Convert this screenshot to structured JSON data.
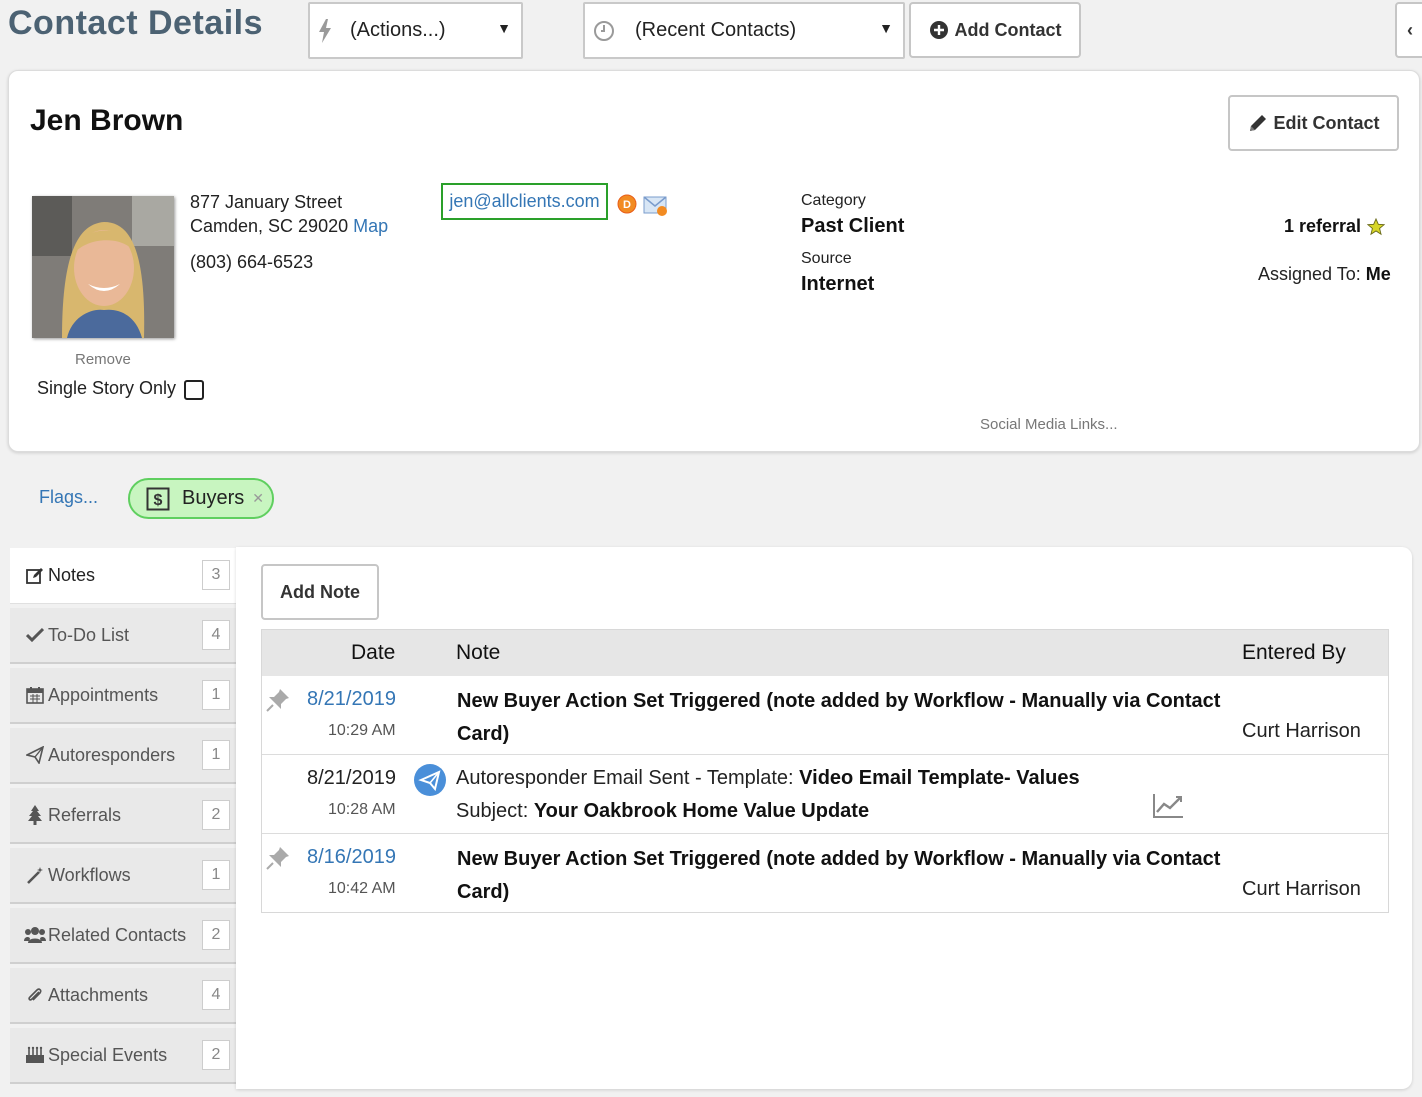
{
  "header": {
    "title": "Contact Details",
    "actions_label": "(Actions...)",
    "recent_label": "(Recent Contacts)",
    "add_contact_label": "Add Contact"
  },
  "contact": {
    "name": "Jen Brown",
    "edit_label": "Edit Contact",
    "address_line1": "877 January Street",
    "address_line2": "Camden, SC 29020",
    "map_label": "Map",
    "phone": "(803) 664-6523",
    "email": "jen@allclients.com",
    "remove_label": "Remove",
    "single_story_label": "Single Story Only",
    "category_label": "Category",
    "category_value": "Past Client",
    "source_label": "Source",
    "source_value": "Internet",
    "referral_text": "1 referral",
    "assigned_label": "Assigned To:",
    "assigned_value": "Me",
    "social_links_label": "Social Media Links..."
  },
  "flags": {
    "flags_label": "Flags...",
    "tag_label": "Buyers"
  },
  "sidebar": {
    "items": [
      {
        "label": "Notes",
        "count": "3",
        "icon": "edit-icon"
      },
      {
        "label": "To-Do List",
        "count": "4",
        "icon": "check-icon"
      },
      {
        "label": "Appointments",
        "count": "1",
        "icon": "calendar-icon"
      },
      {
        "label": "Autoresponders",
        "count": "1",
        "icon": "paper-plane-icon"
      },
      {
        "label": "Referrals",
        "count": "2",
        "icon": "tree-icon"
      },
      {
        "label": "Workflows",
        "count": "1",
        "icon": "magic-wand-icon"
      },
      {
        "label": "Related Contacts",
        "count": "2",
        "icon": "users-icon"
      },
      {
        "label": "Attachments",
        "count": "4",
        "icon": "paperclip-icon"
      },
      {
        "label": "Special Events",
        "count": "2",
        "icon": "birthday-cake-icon"
      }
    ]
  },
  "notes": {
    "add_note_label": "Add Note",
    "columns": {
      "date": "Date",
      "note": "Note",
      "entered_by": "Entered By"
    },
    "rows": [
      {
        "date": "8/21/2019",
        "time": "10:29 AM",
        "note_line1": "New Buyer Action Set Triggered (note added by Workflow - Manually via Contact",
        "note_line2": "Card)",
        "entered_by": "Curt Harrison"
      },
      {
        "date": "8/21/2019",
        "time": "10:28 AM",
        "template_prefix": "Autoresponder Email Sent - Template:",
        "template_name": "Video Email Template- Values",
        "subject_prefix": "Subject:",
        "subject": "Your Oakbrook Home Value Update"
      },
      {
        "date": "8/16/2019",
        "time": "10:42 AM",
        "note_line1": "New Buyer Action Set Triggered (note added by Workflow - Manually via Contact",
        "note_line2": "Card)",
        "entered_by": "Curt Harrison"
      }
    ]
  },
  "colors": {
    "title": "#4c6273",
    "link": "#3476b5",
    "tag_bg": "#c8f5c0",
    "tag_border": "#5fcf5f",
    "email_highlight": "#2aa02a"
  }
}
